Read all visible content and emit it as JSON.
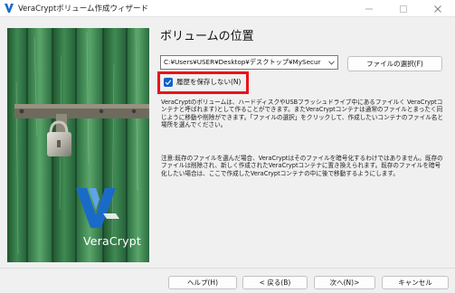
{
  "window": {
    "title": "VeraCryptボリューム作成ウィザード",
    "icon": "veracrypt-app-icon",
    "controls": [
      "minimize-icon",
      "maximize-icon",
      "close-icon"
    ]
  },
  "sidebar": {
    "image": "green-wooden-door-with-padlock",
    "logo_text": "VeraCrypt"
  },
  "main": {
    "heading": "ボリュームの位置",
    "path_value": "C:¥Users¥USER¥Desktop¥デスクトップ¥MySecur",
    "select_file_label": "ファイルの選択(F)",
    "no_history_label": "履歴を保存しない(N)",
    "no_history_checked": true,
    "description": "VeraCryptのボリュームは、ハードディスクやUSBフラッシュドライブ中にあるファイルく VeraCryptコンテナと呼ばれます)として作ることができます。またVeraCryptコンテナは通常のファイルとまったく同じように移動や削除ができます。「ファイルの選択」をクリックして、作成したいコンテナのファイル名と場所を選んでください。",
    "note": "注意:既存のファイルを選んだ場合、VeraCryptはそのファイルを暗号化するわけではありません。既存のファイルは削除され、新しく作成されたVeraCryptコンテナに置き換えられます。既存のファイルを暗号化したい場合は、ここで作成したVeraCryptコンテナの中に後で移動するようにします。"
  },
  "footer": {
    "help_label": "ヘルプ(H)",
    "back_label": "< 戻る(B)",
    "next_label": "次へ(N)>",
    "cancel_label": "キャンセル"
  },
  "colors": {
    "highlight": "#e8141b",
    "checkbox": "#1062c9",
    "door_green": "#2f6e3f"
  }
}
